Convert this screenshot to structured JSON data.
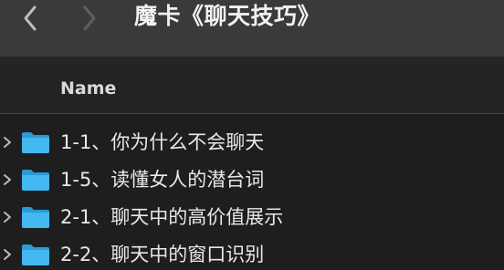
{
  "window": {
    "title": "魔卡《聊天技巧》"
  },
  "toolbar": {
    "back_icon": "chevron-left-icon",
    "forward_icon": "chevron-right-icon"
  },
  "columns": {
    "name_header": "Name"
  },
  "items": [
    {
      "label": "1-1、你为什么不会聊天",
      "icon": "folder-icon"
    },
    {
      "label": "1-5、读懂女人的潜台词",
      "icon": "folder-icon"
    },
    {
      "label": "2-1、聊天中的高价值展示",
      "icon": "folder-icon"
    },
    {
      "label": "2-2、聊天中的窗口识别",
      "icon": "folder-icon"
    }
  ],
  "colors": {
    "folder": "#3fb6ef",
    "background": "#1e1e1e",
    "toolbar": "#3a3a3c"
  }
}
